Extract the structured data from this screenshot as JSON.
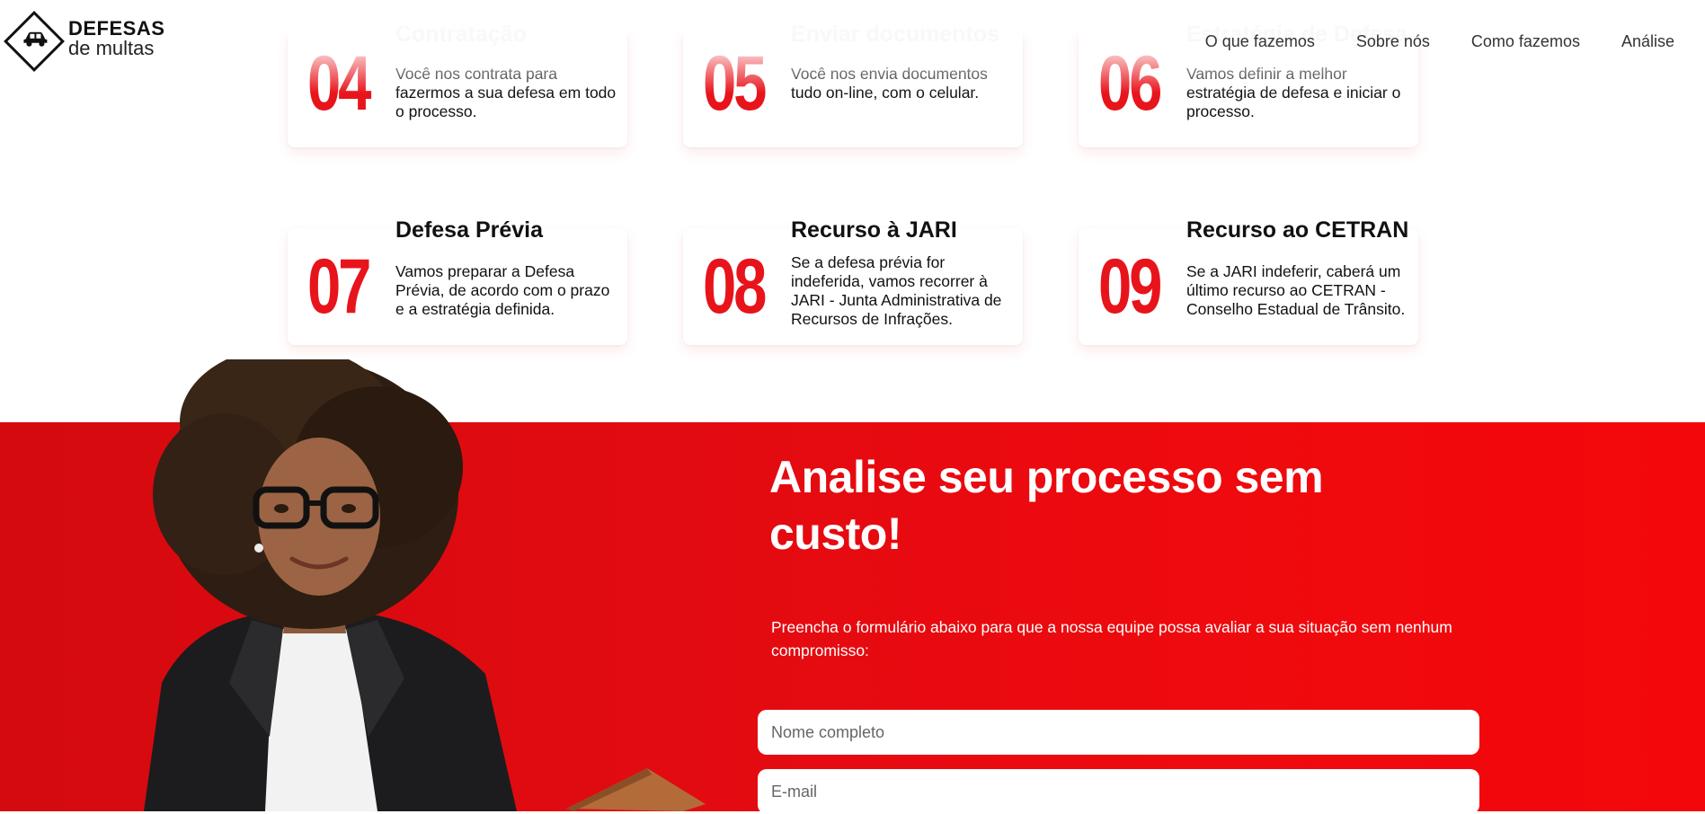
{
  "brand": {
    "line1": "DEFESAS",
    "line2": "de multas"
  },
  "nav": [
    {
      "label": "O que fazemos"
    },
    {
      "label": "Sobre nós"
    },
    {
      "label": "Como fazemos"
    },
    {
      "label": "Análise"
    }
  ],
  "steps": [
    {
      "number": "04",
      "title": "Contratação",
      "desc": "Você nos contrata para fazermos a sua defesa em todo o processo."
    },
    {
      "number": "05",
      "title": "Enviar documentos",
      "desc": "Você nos envia documentos tudo on-line, com o celular."
    },
    {
      "number": "06",
      "title": "Estratégia de Defesa",
      "desc": "Vamos definir a melhor estratégia de defesa e iniciar o processo."
    },
    {
      "number": "07",
      "title": "Defesa Prévia",
      "desc": "Vamos preparar a Defesa Prévia, de acordo com o prazo e a estratégia definida."
    },
    {
      "number": "08",
      "title": "Recurso à JARI",
      "desc": "Se a defesa prévia for indeferida, vamos recorrer à JARI - Junta Administrativa de Recursos de Infrações."
    },
    {
      "number": "09",
      "title": "Recurso ao CETRAN",
      "desc": "Se a JARI indeferir, caberá um último recurso ao CETRAN - Conselho Estadual de Trânsito."
    }
  ],
  "cta": {
    "title": "Analise seu processo sem custo!",
    "subtitle": "Preencha o formulário abaixo para que a nossa equipe possa avaliar a sua situação sem nenhum compromisso:",
    "name_placeholder": "Nome completo",
    "email_placeholder": "E-mail"
  },
  "colors": {
    "accent": "#e8141b",
    "cta_background": "#e20b11"
  }
}
